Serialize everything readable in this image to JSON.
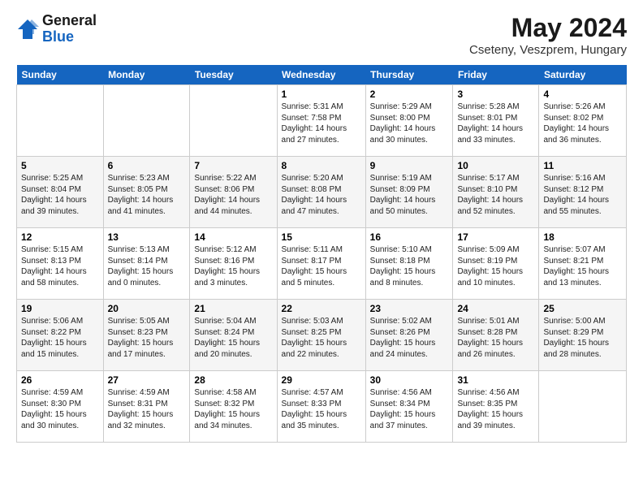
{
  "header": {
    "logo_general": "General",
    "logo_blue": "Blue",
    "month_year": "May 2024",
    "location": "Cseteny, Veszprem, Hungary"
  },
  "weekdays": [
    "Sunday",
    "Monday",
    "Tuesday",
    "Wednesday",
    "Thursday",
    "Friday",
    "Saturday"
  ],
  "weeks": [
    [
      {
        "day": "",
        "sunrise": "",
        "sunset": "",
        "daylight": ""
      },
      {
        "day": "",
        "sunrise": "",
        "sunset": "",
        "daylight": ""
      },
      {
        "day": "",
        "sunrise": "",
        "sunset": "",
        "daylight": ""
      },
      {
        "day": "1",
        "sunrise": "Sunrise: 5:31 AM",
        "sunset": "Sunset: 7:58 PM",
        "daylight": "Daylight: 14 hours and 27 minutes."
      },
      {
        "day": "2",
        "sunrise": "Sunrise: 5:29 AM",
        "sunset": "Sunset: 8:00 PM",
        "daylight": "Daylight: 14 hours and 30 minutes."
      },
      {
        "day": "3",
        "sunrise": "Sunrise: 5:28 AM",
        "sunset": "Sunset: 8:01 PM",
        "daylight": "Daylight: 14 hours and 33 minutes."
      },
      {
        "day": "4",
        "sunrise": "Sunrise: 5:26 AM",
        "sunset": "Sunset: 8:02 PM",
        "daylight": "Daylight: 14 hours and 36 minutes."
      }
    ],
    [
      {
        "day": "5",
        "sunrise": "Sunrise: 5:25 AM",
        "sunset": "Sunset: 8:04 PM",
        "daylight": "Daylight: 14 hours and 39 minutes."
      },
      {
        "day": "6",
        "sunrise": "Sunrise: 5:23 AM",
        "sunset": "Sunset: 8:05 PM",
        "daylight": "Daylight: 14 hours and 41 minutes."
      },
      {
        "day": "7",
        "sunrise": "Sunrise: 5:22 AM",
        "sunset": "Sunset: 8:06 PM",
        "daylight": "Daylight: 14 hours and 44 minutes."
      },
      {
        "day": "8",
        "sunrise": "Sunrise: 5:20 AM",
        "sunset": "Sunset: 8:08 PM",
        "daylight": "Daylight: 14 hours and 47 minutes."
      },
      {
        "day": "9",
        "sunrise": "Sunrise: 5:19 AM",
        "sunset": "Sunset: 8:09 PM",
        "daylight": "Daylight: 14 hours and 50 minutes."
      },
      {
        "day": "10",
        "sunrise": "Sunrise: 5:17 AM",
        "sunset": "Sunset: 8:10 PM",
        "daylight": "Daylight: 14 hours and 52 minutes."
      },
      {
        "day": "11",
        "sunrise": "Sunrise: 5:16 AM",
        "sunset": "Sunset: 8:12 PM",
        "daylight": "Daylight: 14 hours and 55 minutes."
      }
    ],
    [
      {
        "day": "12",
        "sunrise": "Sunrise: 5:15 AM",
        "sunset": "Sunset: 8:13 PM",
        "daylight": "Daylight: 14 hours and 58 minutes."
      },
      {
        "day": "13",
        "sunrise": "Sunrise: 5:13 AM",
        "sunset": "Sunset: 8:14 PM",
        "daylight": "Daylight: 15 hours and 0 minutes."
      },
      {
        "day": "14",
        "sunrise": "Sunrise: 5:12 AM",
        "sunset": "Sunset: 8:16 PM",
        "daylight": "Daylight: 15 hours and 3 minutes."
      },
      {
        "day": "15",
        "sunrise": "Sunrise: 5:11 AM",
        "sunset": "Sunset: 8:17 PM",
        "daylight": "Daylight: 15 hours and 5 minutes."
      },
      {
        "day": "16",
        "sunrise": "Sunrise: 5:10 AM",
        "sunset": "Sunset: 8:18 PM",
        "daylight": "Daylight: 15 hours and 8 minutes."
      },
      {
        "day": "17",
        "sunrise": "Sunrise: 5:09 AM",
        "sunset": "Sunset: 8:19 PM",
        "daylight": "Daylight: 15 hours and 10 minutes."
      },
      {
        "day": "18",
        "sunrise": "Sunrise: 5:07 AM",
        "sunset": "Sunset: 8:21 PM",
        "daylight": "Daylight: 15 hours and 13 minutes."
      }
    ],
    [
      {
        "day": "19",
        "sunrise": "Sunrise: 5:06 AM",
        "sunset": "Sunset: 8:22 PM",
        "daylight": "Daylight: 15 hours and 15 minutes."
      },
      {
        "day": "20",
        "sunrise": "Sunrise: 5:05 AM",
        "sunset": "Sunset: 8:23 PM",
        "daylight": "Daylight: 15 hours and 17 minutes."
      },
      {
        "day": "21",
        "sunrise": "Sunrise: 5:04 AM",
        "sunset": "Sunset: 8:24 PM",
        "daylight": "Daylight: 15 hours and 20 minutes."
      },
      {
        "day": "22",
        "sunrise": "Sunrise: 5:03 AM",
        "sunset": "Sunset: 8:25 PM",
        "daylight": "Daylight: 15 hours and 22 minutes."
      },
      {
        "day": "23",
        "sunrise": "Sunrise: 5:02 AM",
        "sunset": "Sunset: 8:26 PM",
        "daylight": "Daylight: 15 hours and 24 minutes."
      },
      {
        "day": "24",
        "sunrise": "Sunrise: 5:01 AM",
        "sunset": "Sunset: 8:28 PM",
        "daylight": "Daylight: 15 hours and 26 minutes."
      },
      {
        "day": "25",
        "sunrise": "Sunrise: 5:00 AM",
        "sunset": "Sunset: 8:29 PM",
        "daylight": "Daylight: 15 hours and 28 minutes."
      }
    ],
    [
      {
        "day": "26",
        "sunrise": "Sunrise: 4:59 AM",
        "sunset": "Sunset: 8:30 PM",
        "daylight": "Daylight: 15 hours and 30 minutes."
      },
      {
        "day": "27",
        "sunrise": "Sunrise: 4:59 AM",
        "sunset": "Sunset: 8:31 PM",
        "daylight": "Daylight: 15 hours and 32 minutes."
      },
      {
        "day": "28",
        "sunrise": "Sunrise: 4:58 AM",
        "sunset": "Sunset: 8:32 PM",
        "daylight": "Daylight: 15 hours and 34 minutes."
      },
      {
        "day": "29",
        "sunrise": "Sunrise: 4:57 AM",
        "sunset": "Sunset: 8:33 PM",
        "daylight": "Daylight: 15 hours and 35 minutes."
      },
      {
        "day": "30",
        "sunrise": "Sunrise: 4:56 AM",
        "sunset": "Sunset: 8:34 PM",
        "daylight": "Daylight: 15 hours and 37 minutes."
      },
      {
        "day": "31",
        "sunrise": "Sunrise: 4:56 AM",
        "sunset": "Sunset: 8:35 PM",
        "daylight": "Daylight: 15 hours and 39 minutes."
      },
      {
        "day": "",
        "sunrise": "",
        "sunset": "",
        "daylight": ""
      }
    ]
  ]
}
